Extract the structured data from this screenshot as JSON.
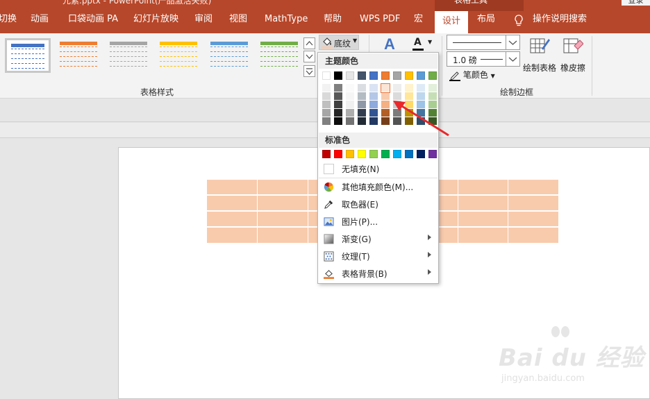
{
  "window": {
    "title_partial": "元素.pptx - PowerPoint(产品激活失败)",
    "context_group": "表格工具",
    "login_label": "登录"
  },
  "tabs": [
    "切换",
    "动画",
    "口袋动画 PA",
    "幻灯片放映",
    "审阅",
    "视图",
    "MathType",
    "帮助",
    "WPS PDF",
    "宏",
    "设计",
    "布局"
  ],
  "active_tab": "设计",
  "tell_me": "操作说明搜索",
  "ribbon": {
    "table_styles_label": "表格样式",
    "draw_borders_label": "绘制边框",
    "shading_label": "底纹",
    "line_weight": "1.0 磅",
    "pen_color_label": "笔颜色",
    "draw_table_label": "绘制表格",
    "eraser_label": "橡皮擦",
    "style_colors": [
      "#4472c4",
      "#ed7d31",
      "#a5a5a5",
      "#ffc000",
      "#5b9bd5",
      "#70ad47"
    ]
  },
  "dropdown": {
    "theme_colors_header": "主题颜色",
    "standard_colors_header": "标准色",
    "theme_colors": [
      "#ffffff",
      "#000000",
      "#e7e6e6",
      "#44546a",
      "#4472c4",
      "#ed7d31",
      "#a5a5a5",
      "#ffc000",
      "#5b9bd5",
      "#70ad47"
    ],
    "standard_colors": [
      "#c00000",
      "#ff0000",
      "#ffc000",
      "#ffff00",
      "#92d050",
      "#00b050",
      "#00b0f0",
      "#0070c0",
      "#002060",
      "#7030a0"
    ],
    "selected_color": "#f8cbad",
    "no_fill": "无填充(N)",
    "items": [
      {
        "label": "其他填充颜色(M)...",
        "icon": "color-wheel-icon",
        "submenu": false
      },
      {
        "label": "取色器(E)",
        "icon": "eyedropper-icon",
        "submenu": false
      },
      {
        "label": "图片(P)...",
        "icon": "picture-icon",
        "submenu": false
      },
      {
        "label": "渐变(G)",
        "icon": "gradient-icon",
        "submenu": true
      },
      {
        "label": "纹理(T)",
        "icon": "texture-icon",
        "submenu": true
      },
      {
        "label": "表格背景(B)",
        "icon": "table-background-icon",
        "submenu": true
      }
    ]
  },
  "slide": {
    "table_fill": "#f8cbad"
  },
  "watermark": {
    "text": "Bai du 经验",
    "url": "jingyan.baidu.com"
  }
}
